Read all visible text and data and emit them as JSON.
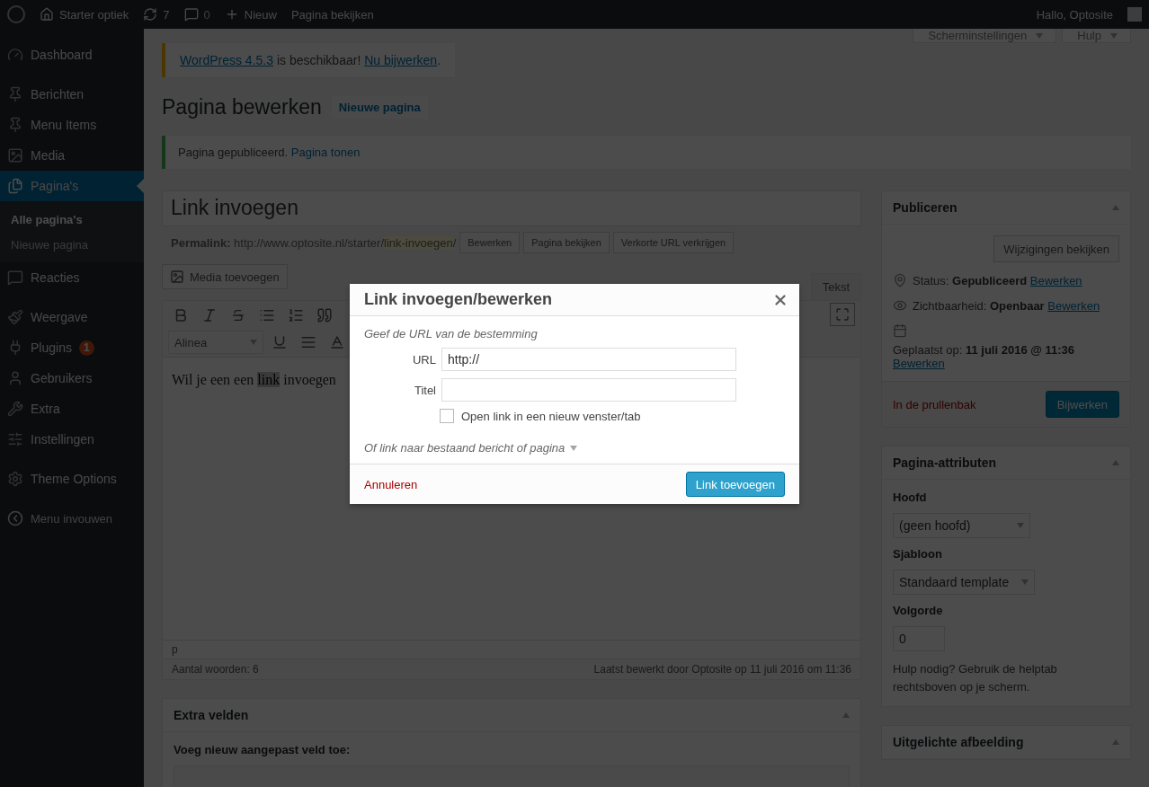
{
  "admin_bar": {
    "site": "Starter optiek",
    "updates": "7",
    "comments": "0",
    "new": "Nieuw",
    "view": "Pagina bekijken",
    "greeting": "Hallo, Optosite"
  },
  "sidebar": {
    "groups": [
      {
        "items": [
          {
            "label": "Dashboard",
            "selected": false
          }
        ]
      },
      {
        "items": [
          {
            "label": "Berichten",
            "selected": false
          },
          {
            "label": "Menu Items",
            "selected": false
          },
          {
            "label": "Media",
            "selected": false
          },
          {
            "label": "Pagina's",
            "selected": true,
            "children": [
              {
                "label": "Alle pagina's",
                "selected": true
              },
              {
                "label": "Nieuwe pagina",
                "selected": false
              }
            ]
          },
          {
            "label": "Reacties",
            "selected": false
          }
        ]
      },
      {
        "items": [
          {
            "label": "Weergave",
            "selected": false
          },
          {
            "label": "Plugins",
            "selected": false,
            "badge": "1"
          },
          {
            "label": "Gebruikers",
            "selected": false
          },
          {
            "label": "Extra",
            "selected": false
          },
          {
            "label": "Instellingen",
            "selected": false
          }
        ]
      },
      {
        "items": [
          {
            "label": "Theme Options",
            "selected": false
          }
        ]
      }
    ],
    "collapse": "Menu invouwen"
  },
  "screen_tabs": [
    "Scherminstellingen",
    "Hulp"
  ],
  "update_notice": [
    {
      "text": "WordPress 4.5.3",
      "link": true
    },
    {
      "text": " is beschikbaar! ",
      "link": false
    },
    {
      "text": "Nu bijwerken",
      "link": true
    },
    {
      "text": ".",
      "link": false
    }
  ],
  "page_title": "Pagina bewerken",
  "add_new": "Nieuwe pagina",
  "success_notice": {
    "text": "Pagina gepubliceerd.",
    "link": "Pagina tonen"
  },
  "post_title": "Link invoegen",
  "permalink": {
    "label": "Permalink:",
    "base": "http://www.optosite.nl/starter/",
    "slug": "link-invoegen",
    "end": "/",
    "buttons": [
      "Bewerken",
      "Pagina bekijken",
      "Verkorte URL verkrijgen"
    ]
  },
  "editor": {
    "media_button": "Media toevoegen",
    "tabs": [
      {
        "label": "Tekst",
        "selected": false
      }
    ],
    "format": "Alinea",
    "content": [
      {
        "text": "Wil je een een ",
        "selected": false
      },
      {
        "text": "link",
        "selected": true
      },
      {
        "text": " invoegen",
        "selected": false
      }
    ],
    "path": "p",
    "word_count": "Aantal woorden: 6",
    "last_edited": "Laatst bewerkt door Optosite op 11 juli 2016 om 11:36"
  },
  "extra_fields": {
    "title": "Extra velden",
    "subtitle": "Voeg nieuw aangepast veld toe:"
  },
  "publish": {
    "title": "Publiceren",
    "preview": "Wijzigingen bekijken",
    "rows": [
      {
        "label": "Status: ",
        "value": "Gepubliceerd",
        "link": "Bewerken"
      },
      {
        "label": "Zichtbaarheid: ",
        "value": "Openbaar",
        "link": "Bewerken"
      },
      {
        "label": "Geplaatst op: ",
        "value": "11 juli 2016 @ 11:36",
        "link": "Bewerken"
      }
    ],
    "trash": "In de prullenbak",
    "update": "Bijwerken"
  },
  "attributes": {
    "title": "Pagina-attributen",
    "parent_label": "Hoofd",
    "parent": "(geen hoofd)",
    "template_label": "Sjabloon",
    "template": "Standaard template",
    "order_label": "Volgorde",
    "order": "0",
    "help": "Hulp nodig? Gebruik de helptab rechtsboven op je scherm."
  },
  "featured": {
    "title": "Uitgelichte afbeelding"
  },
  "dialog": {
    "title": "Link invoegen/bewerken",
    "instruction": "Geef de URL van de bestemming",
    "url_label": "URL",
    "url": "http://",
    "title_label": "Titel",
    "new_tab": {
      "label": "Open link in een nieuw venster/tab",
      "checked": false
    },
    "search_toggle": "Of link naar bestaand bericht of pagina",
    "cancel": "Annuleren",
    "submit": "Link toevoegen"
  }
}
